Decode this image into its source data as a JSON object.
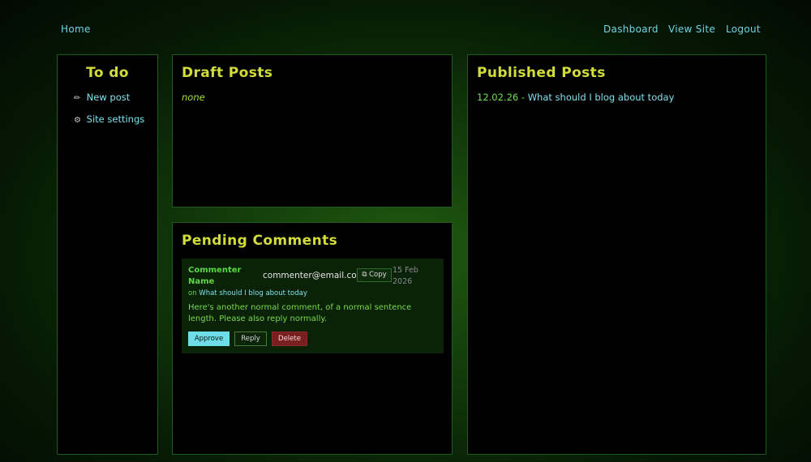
{
  "nav": {
    "home": "Home",
    "dashboard": "Dashboard",
    "view_site": "View Site",
    "logout": "Logout"
  },
  "todo": {
    "title": "To do",
    "items": [
      {
        "icon": "pencil-icon",
        "glyph": "✏",
        "label": "New post"
      },
      {
        "icon": "gear-icon",
        "glyph": "⚙",
        "label": "Site settings"
      }
    ]
  },
  "drafts": {
    "title": "Draft Posts",
    "empty_text": "none"
  },
  "comments": {
    "title": "Pending Comments",
    "items": [
      {
        "name": "Commenter Name",
        "email": "commenter@email.com",
        "copy_label": "Copy",
        "date": "15 Feb 2026",
        "on_prefix": "on",
        "post_title": "What should I blog about today",
        "body": "Here's another normal comment, of a normal sentence length. Please also reply normally.",
        "approve_label": "Approve",
        "reply_label": "Reply",
        "delete_label": "Delete"
      }
    ]
  },
  "published": {
    "title": "Published Posts",
    "items": [
      {
        "date": "12.02.26",
        "separator": " - ",
        "title": "What should I blog about today"
      }
    ]
  },
  "colors": {
    "accent_title": "#d2dc3a",
    "link": "#7ee0ee",
    "green_text": "#5ed64a",
    "panel_border": "#1e5a1e",
    "approve": "#6fdcea",
    "delete": "#7a1f1f"
  }
}
